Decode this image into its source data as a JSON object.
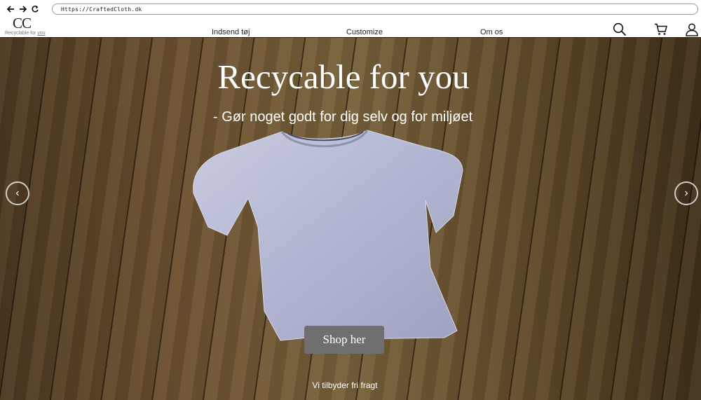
{
  "browser": {
    "url": "Https://CraftedCloth.dk",
    "back_icon": "arrow-left-icon",
    "forward_icon": "arrow-right-icon",
    "reload_icon": "reload-icon"
  },
  "header": {
    "logo_mark": "CC",
    "logo_tagline_prefix": "Recyclable for ",
    "logo_tagline_link": "you",
    "nav": [
      {
        "label": "Indsend tøj"
      },
      {
        "label": "Customize"
      },
      {
        "label": "Om os"
      }
    ],
    "icons": [
      "search-icon",
      "cart-icon",
      "user-icon"
    ]
  },
  "hero": {
    "title": "Recycable for you",
    "subtitle": "- Gør noget godt for dig selv og for miljøet",
    "cta_label": "Shop her",
    "footer_note": "Vi tilbyder fri fragt",
    "prev_icon": "chevron-left-icon",
    "next_icon": "chevron-right-icon"
  },
  "colors": {
    "text_on_hero": "#ffffff",
    "cta_background": "#6f6f6f",
    "header_border": "#1e1e1e"
  }
}
